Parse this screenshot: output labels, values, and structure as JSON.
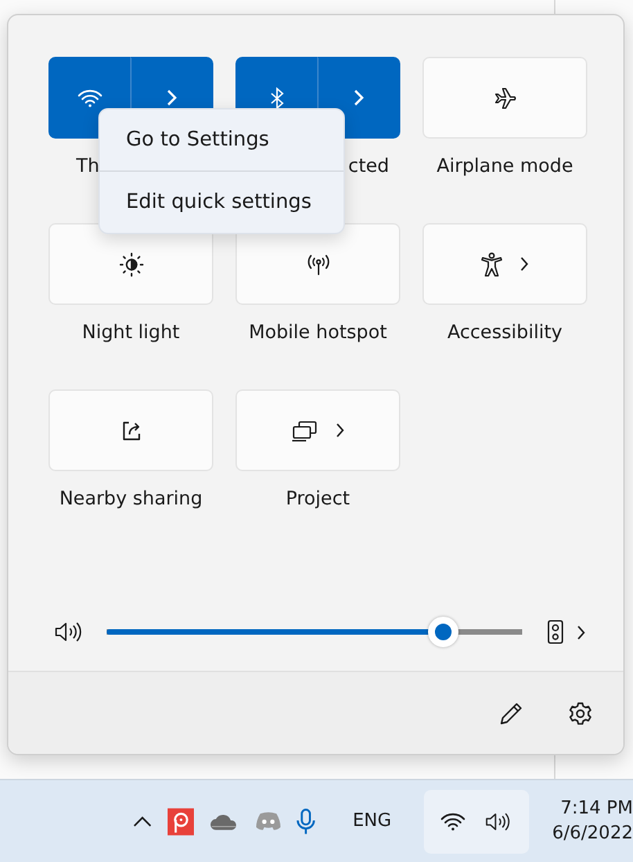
{
  "quick_settings": {
    "tiles": [
      {
        "label": "Th",
        "partly_covered": true,
        "kind": "split",
        "on": true
      },
      {
        "label": "cted",
        "partly_covered": true,
        "kind": "split",
        "on": true
      },
      {
        "label": "Airplane mode",
        "kind": "toggle",
        "on": false
      },
      {
        "label": "Night light",
        "kind": "toggle",
        "on": false
      },
      {
        "label": "Mobile hotspot",
        "kind": "toggle",
        "on": false
      },
      {
        "label": "Accessibility",
        "kind": "expand",
        "on": false
      },
      {
        "label": "Nearby sharing",
        "kind": "toggle",
        "on": false
      },
      {
        "label": "Project",
        "kind": "expand",
        "on": false
      }
    ],
    "volume": {
      "level": 0.81
    }
  },
  "context_menu": {
    "items": [
      "Go to Settings",
      "Edit quick settings"
    ]
  },
  "taskbar": {
    "language": "ENG",
    "time": "7:14 PM",
    "date": "6/6/2022"
  }
}
